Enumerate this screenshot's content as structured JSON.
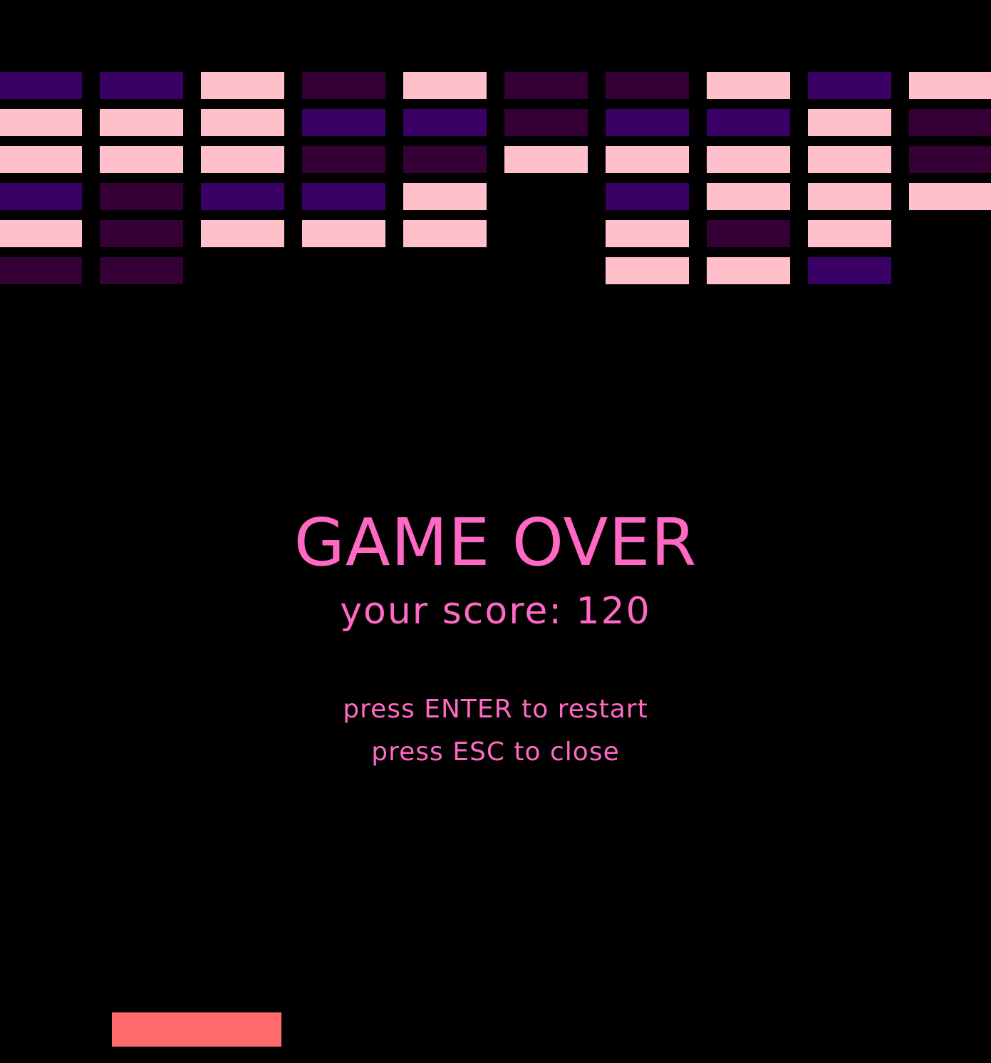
{
  "palette": {
    "background": "#000000",
    "text": "#ff69c4",
    "paddle": "#ff6b6b",
    "brick_colors": {
      "P": "#ffc0cb",
      "V": "#3a0066",
      "M": "#350036"
    }
  },
  "bricks": {
    "rows": [
      [
        "V",
        "V",
        "P",
        "M",
        "P",
        "M",
        "M",
        "P",
        "V",
        "P"
      ],
      [
        "P",
        "P",
        "P",
        "V",
        "V",
        "M",
        "V",
        "V",
        "P",
        "M"
      ],
      [
        "P",
        "P",
        "P",
        "M",
        "M",
        "P",
        "P",
        "P",
        "P",
        "M"
      ],
      [
        "V",
        "M",
        "V",
        "V",
        "P",
        null,
        "V",
        "P",
        "P",
        "P"
      ],
      [
        "P",
        "M",
        "P",
        "P",
        "P",
        null,
        "P",
        "M",
        "P",
        null
      ],
      [
        "M",
        "M",
        null,
        null,
        null,
        null,
        "P",
        "P",
        "V",
        null
      ]
    ]
  },
  "game_over": {
    "title": "GAME OVER",
    "score_text": "your score: 120",
    "restart_hint": "press ENTER to restart",
    "close_hint": "press ESC to close"
  }
}
